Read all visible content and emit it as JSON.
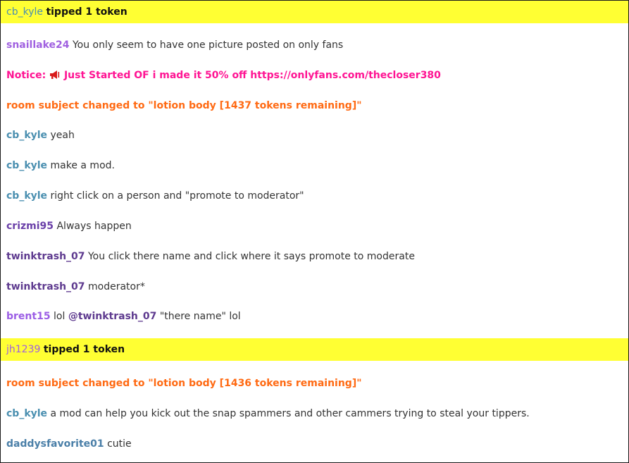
{
  "colors": {
    "tip_bg": "#ffff33",
    "notice": "#ff1493",
    "room_subject": "#ff6a13",
    "user_cb_kyle": "#4a8fb0",
    "user_snaillake24": "#a060e0",
    "user_crizmi95": "#6a3fa8",
    "user_twinktrash_07": "#5e3a8f",
    "user_brent15": "#9b5de5",
    "user_jh1239": "#a060e0",
    "user_daddysfavorite01": "#4a7fa8"
  },
  "messages": [
    {
      "user": "cb_kyle",
      "text": "tipped 1 token"
    },
    {
      "user": "snaillake24",
      "text": "You only seem to have one picture posted on only fans"
    },
    {
      "prefix": "Notice: ",
      "icon": "megaphone-icon",
      "text": " Just Started OF i made it 50% off https://onlyfans.com/thecloser380"
    },
    {
      "text": "room subject changed to \"lotion body [1437 tokens remaining]\""
    },
    {
      "user": "cb_kyle",
      "text": "yeah"
    },
    {
      "user": "cb_kyle",
      "text": "make a mod."
    },
    {
      "user": "cb_kyle",
      "text": "right click on a person and \"promote to moderator\""
    },
    {
      "user": "crizmi95",
      "text": "Always happen"
    },
    {
      "user": "twinktrash_07",
      "text": "You click there name and click where it says promote to moderate"
    },
    {
      "user": "twinktrash_07",
      "text": "moderator*"
    },
    {
      "user": "brent15",
      "text_before": "lol",
      "mention": "@twinktrash_07",
      "text_after": "\"there name\" lol"
    },
    {
      "user": "jh1239",
      "text": "tipped 1 token"
    },
    {
      "text": "room subject changed to \"lotion body [1436 tokens remaining]\""
    },
    {
      "user": "cb_kyle",
      "text": "a mod can help you kick out the snap spammers and other cammers trying to steal your tippers."
    },
    {
      "user": "daddysfavorite01",
      "text": "cutie"
    }
  ]
}
